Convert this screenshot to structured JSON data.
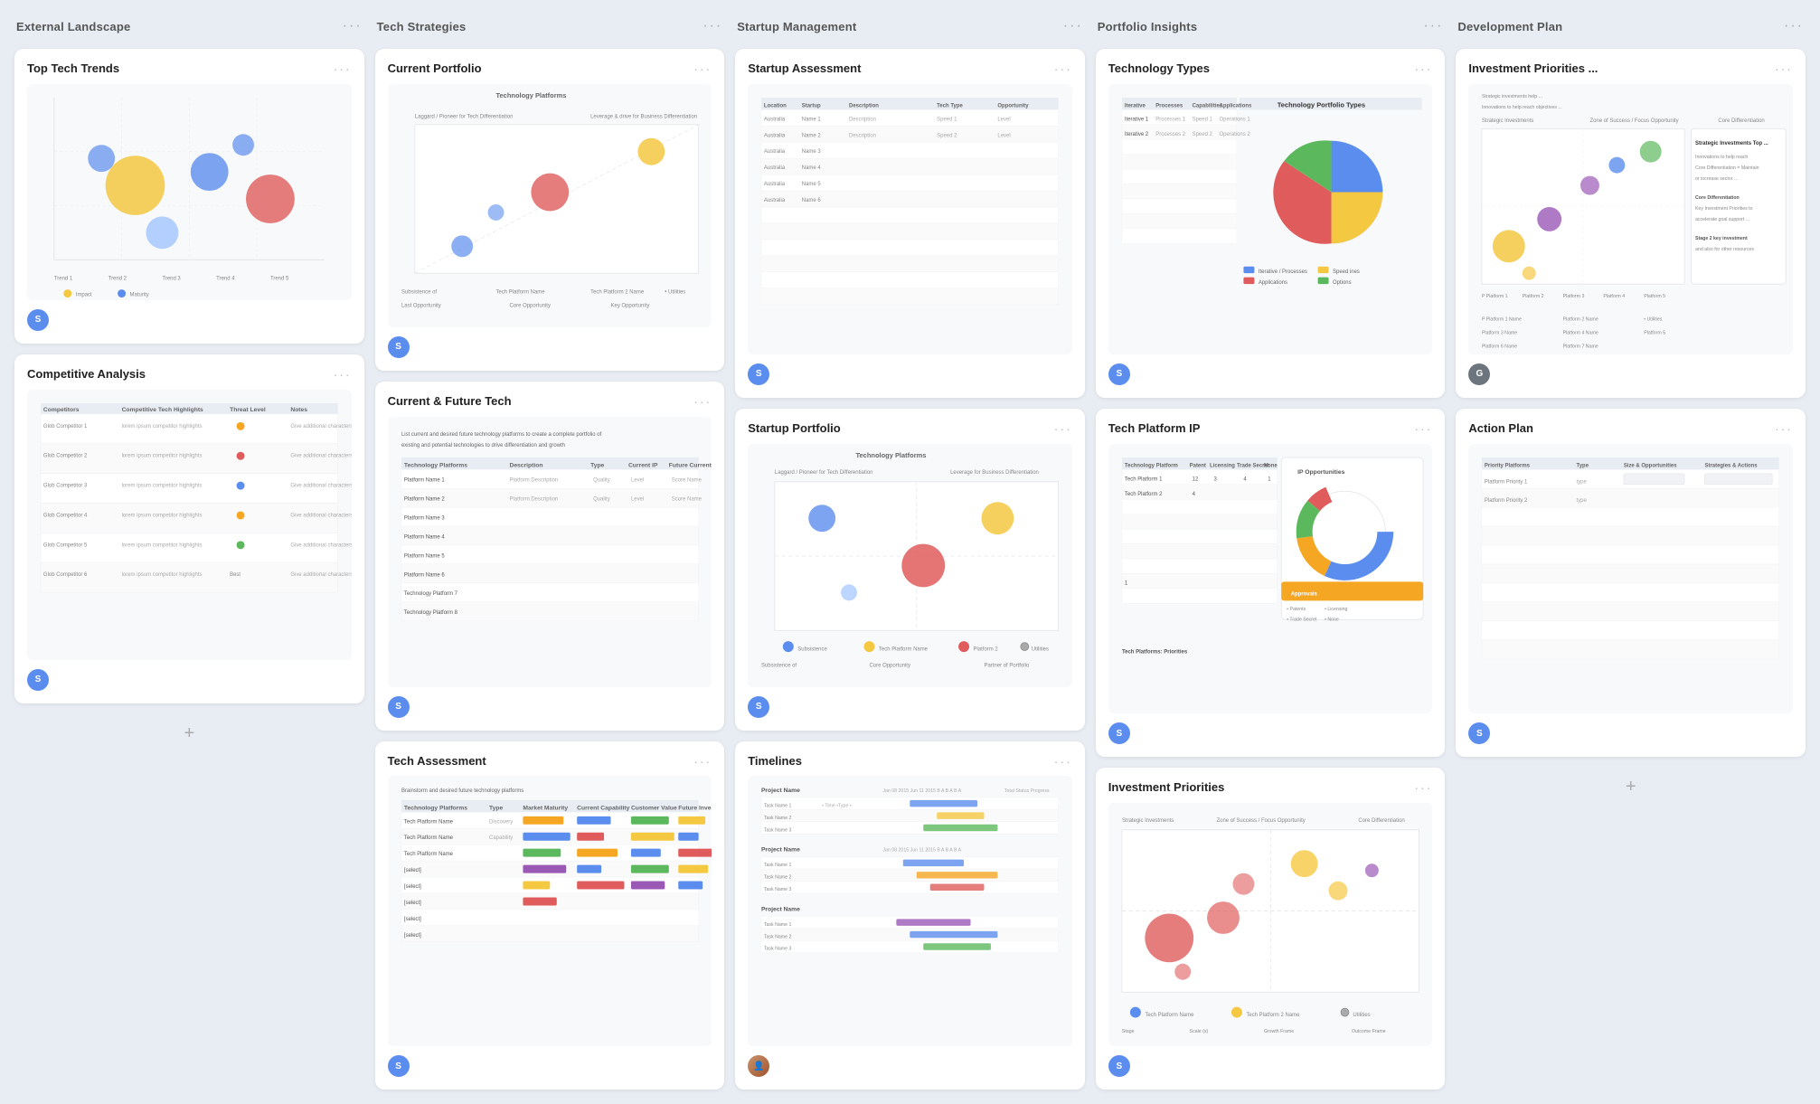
{
  "columns": [
    {
      "id": "col1",
      "title": "External Landscape",
      "cards": [
        {
          "id": "top-tech-trends",
          "title": "Top Tech Trends",
          "avatar": "S",
          "avatarType": "s",
          "preview": "bubble-chart"
        },
        {
          "id": "competitive-analysis",
          "title": "Competitive Analysis",
          "avatar": "S",
          "avatarType": "s",
          "preview": "table"
        }
      ],
      "showAdd": true
    },
    {
      "id": "col2",
      "title": "Tech Strategies",
      "cards": [
        {
          "id": "current-portfolio",
          "title": "Current Portfolio",
          "avatar": "S",
          "avatarType": "s",
          "preview": "scatter-chart"
        },
        {
          "id": "current-future-tech",
          "title": "Current & Future Tech",
          "avatar": "S",
          "avatarType": "s",
          "preview": "list-table"
        },
        {
          "id": "tech-assessment",
          "title": "Tech Assessment",
          "avatar": "S",
          "avatarType": "s",
          "preview": "colored-table"
        }
      ],
      "showAdd": false
    },
    {
      "id": "col3",
      "title": "Startup Management",
      "cards": [
        {
          "id": "startup-assessment",
          "title": "Startup Assessment",
          "avatar": "S",
          "avatarType": "s",
          "preview": "startup-table"
        },
        {
          "id": "startup-portfolio",
          "title": "Startup Portfolio",
          "avatar": "S",
          "avatarType": "s",
          "preview": "startup-scatter"
        },
        {
          "id": "timelines",
          "title": "Timelines",
          "avatar": "photo",
          "avatarType": "photo",
          "preview": "gantt"
        }
      ],
      "showAdd": false
    },
    {
      "id": "col4",
      "title": "Portfolio Insights",
      "cards": [
        {
          "id": "technology-types",
          "title": "Technology Types",
          "avatar": "S",
          "avatarType": "s",
          "preview": "pie-chart"
        },
        {
          "id": "tech-platform-ip",
          "title": "Tech Platform IP",
          "avatar": "S",
          "avatarType": "s",
          "preview": "ip-table"
        },
        {
          "id": "investment-priorities",
          "title": "Investment Priorities",
          "avatar": "S",
          "avatarType": "s",
          "preview": "invest-scatter"
        }
      ],
      "showAdd": false
    },
    {
      "id": "col5",
      "title": "Development Plan",
      "cards": [
        {
          "id": "investment-priorities-dev",
          "title": "Investment Priorities ...",
          "avatar": "G",
          "avatarType": "g",
          "preview": "dev-scatter"
        },
        {
          "id": "action-plan",
          "title": "Action Plan",
          "avatar": "S",
          "avatarType": "s",
          "preview": "action-table"
        }
      ],
      "showAdd": true
    }
  ],
  "ui": {
    "menu_dots": "···",
    "add_icon": "+",
    "avatar_s": "S",
    "avatar_g": "G"
  }
}
